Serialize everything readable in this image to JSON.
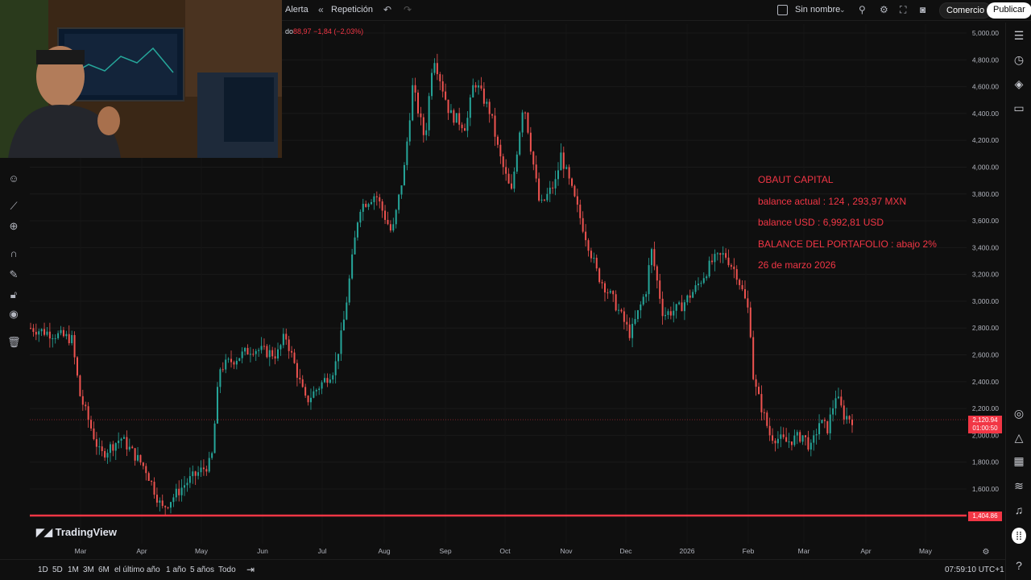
{
  "topbar": {
    "alert_label": "Alerta",
    "replay_label": "Repetición",
    "layout_name": "Sin nombre",
    "trade_label": "Comercio",
    "publish_label": "Publicar"
  },
  "legend": {
    "symbol": "do",
    "price": "88,97",
    "change": "−1,84",
    "change_pct": "(−2,03%)"
  },
  "annotation": {
    "line1": "OBAUT CAPITAL",
    "line2": "balance actual : 124 , 293,97 MXN",
    "line3": "balance USD : 6,992,81 USD",
    "line4": "BALANCE DEL PORTAFOLIO : abajo 2%",
    "line5": "26 de marzo 2026"
  },
  "brand": "TradingView",
  "price_axis": [
    "5,000.00",
    "4,800.00",
    "4,600.00",
    "4,400.00",
    "4,200.00",
    "4,000.00",
    "3,800.00",
    "3,600.00",
    "3,400.00",
    "3,200.00",
    "3,000.00",
    "2,800.00",
    "2,600.00",
    "2,400.00",
    "2,200.00",
    "2,000.00",
    "1,800.00",
    "1,600.00"
  ],
  "current_price": {
    "value": "2,120.94",
    "countdown": "01:00:50"
  },
  "level_price": "1,404.86",
  "time_axis": [
    "Mar",
    "Apr",
    "May",
    "Jun",
    "Jul",
    "Aug",
    "Sep",
    "Oct",
    "Nov",
    "Dec",
    "2026",
    "Feb",
    "Mar",
    "Apr",
    "May"
  ],
  "ranges": [
    "1D",
    "5D",
    "1M",
    "3M",
    "6M",
    "el último año",
    "1 año",
    "5 años",
    "Todo"
  ],
  "clock": "07:59:10 UTC+1",
  "colors": {
    "up": "#26a69a",
    "down": "#ef5350",
    "accent": "#f23645",
    "bg": "#0f0f0f"
  },
  "chart_data": {
    "type": "line",
    "x": [
      "Feb",
      "Mar",
      "Apr",
      "May",
      "Jun",
      "Jul",
      "Aug",
      "Sep",
      "Oct",
      "Nov",
      "Dec",
      "2026",
      "Feb",
      "Mar"
    ],
    "values": [
      2900,
      2700,
      1800,
      1600,
      2100,
      2600,
      3200,
      4500,
      4400,
      4300,
      3300,
      3000,
      2900,
      2100
    ],
    "ylim": [
      1500,
      5000
    ]
  }
}
